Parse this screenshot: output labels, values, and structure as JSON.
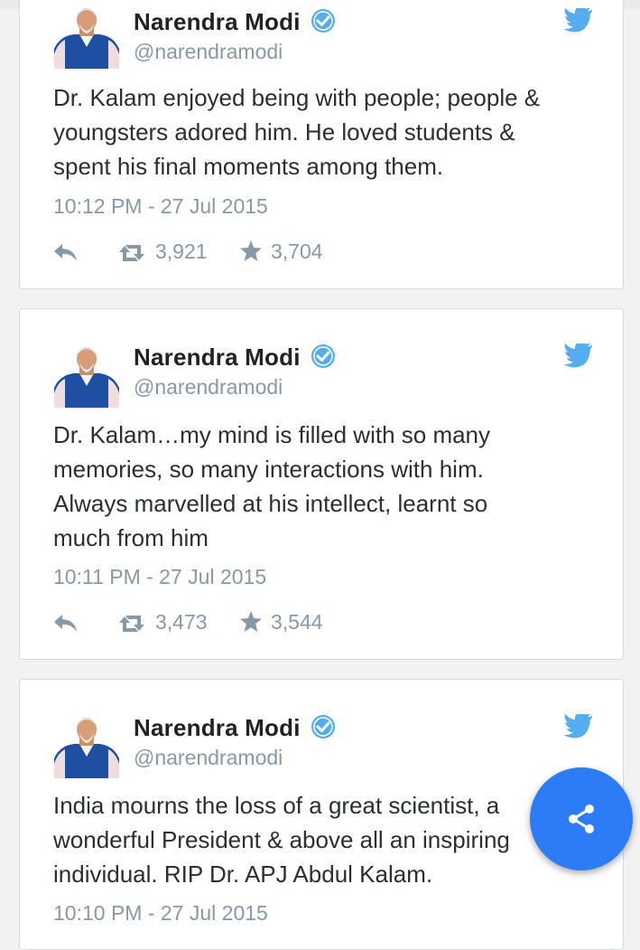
{
  "tweets": [
    {
      "author": "Narendra Modi",
      "handle": "@narendramodi",
      "text": "Dr. Kalam enjoyed being with people; people &\nyoungsters adored him. He loved students &\nspent his final moments among them.",
      "timestamp": "10:12 PM - 27 Jul 2015",
      "retweets": "3,921",
      "favorites": "3,704"
    },
    {
      "author": "Narendra Modi",
      "handle": "@narendramodi",
      "text": "Dr. Kalam…my mind is filled with so many\nmemories, so many interactions with him.\nAlways marvelled at his intellect, learnt so\nmuch from him",
      "timestamp": "10:11 PM - 27 Jul 2015",
      "retweets": "3,473",
      "favorites": "3,544"
    },
    {
      "author": "Narendra Modi",
      "handle": "@narendramodi",
      "text": "India mourns the loss of a great scientist, a\nwonderful President & above all an inspiring\nindividual. RIP Dr. APJ Abdul Kalam.",
      "timestamp": "10:10 PM - 27 Jul 2015"
    }
  ],
  "icons": {
    "verified": "verified-badge-icon",
    "brand": "twitter-bird-icon",
    "reply": "reply-icon",
    "retweet": "retweet-icon",
    "favorite": "star-icon",
    "share": "share-icon"
  },
  "colors": {
    "twitter_blue": "#55acee",
    "fab_blue": "#2b7cf6",
    "muted_text": "#8899a6",
    "top_accent": "#f4b400"
  }
}
